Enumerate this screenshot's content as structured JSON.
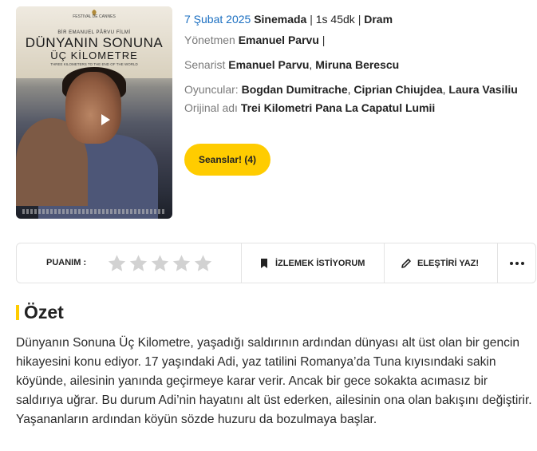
{
  "poster": {
    "title_line1": "DÜNYANIN SONUNA",
    "title_line2": "ÜÇ KİLOMETRE",
    "director_line": "BİR EMANUEL PÂRVU FİLMİ",
    "tagline": "THREE KILOMETERS TO THE END OF THE WORLD",
    "festival": "FESTIVAL DE CANNES",
    "icon": "play-icon"
  },
  "info": {
    "date": "7 Şubat 2025",
    "status": "Sinemada",
    "duration": "1s 45dk",
    "genre": "Dram",
    "director_label": "Yönetmen",
    "director": "Emanuel Parvu",
    "writer_label": "Senarist",
    "writers": [
      "Emanuel Parvu",
      "Miruna Berescu"
    ],
    "cast_label": "Oyuncular:",
    "cast": [
      "Bogdan Dumitrache",
      "Ciprian Chiujdea",
      "Laura Vasiliu"
    ],
    "original_label": "Orijinal adı",
    "original_title": "Trei Kilometri Pana La Capatul Lumii"
  },
  "sessions_button": "Seanslar! (4)",
  "actions": {
    "rating_label": "PUANIM :",
    "stars_total": 5,
    "stars_filled": 0,
    "watchlist_label": "İZLEMEK İSTİYORUM",
    "review_label": "ELEŞTİRİ YAZ!",
    "icons": [
      "bookmark-icon",
      "pencil-icon",
      "more-icon"
    ]
  },
  "summary": {
    "heading": "Özet",
    "text": "Dünyanın Sonuna Üç Kilometre, yaşadığı saldırının ardından dünyası alt üst olan bir gencin hikayesini konu ediyor. 17 yaşındaki Adi, yaz tatilini  Romanya’da Tuna kıyısındaki sakin köyünde, ailesinin yanında geçirmeye karar verir. Ancak bir gece sokakta acımasız bir saldırıya uğrar. Bu durum Adi’nin hayatını alt üst ederken, ailesinin ona olan bakışını değiştirir. Yaşananların ardından köyün sözde huzuru da bozulmaya başlar."
  },
  "colors": {
    "accent": "#ffcc00",
    "link": "#1b6fc1",
    "muted": "#7a7a7a"
  }
}
